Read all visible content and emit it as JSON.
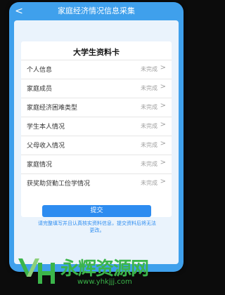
{
  "header": {
    "title": "家庭经济情况信息采集"
  },
  "card": {
    "title": "大学生资料卡",
    "rows": [
      {
        "label": "个人信息",
        "status": "未完成"
      },
      {
        "label": "家庭成员",
        "status": "未完成"
      },
      {
        "label": "家庭经济困难类型",
        "status": "未完成"
      },
      {
        "label": "学生本人情况",
        "status": "未完成"
      },
      {
        "label": "父母收入情况",
        "status": "未完成"
      },
      {
        "label": "家庭情况",
        "status": "未完成"
      },
      {
        "label": "获奖助贷勤工俭学情况",
        "status": "未完成"
      }
    ]
  },
  "footer": {
    "submit_label": "提交",
    "notice": "请完整填写并且认真核实资料信息，提交资料后将无法更改。"
  },
  "watermark": {
    "brand": "永辉资源网",
    "url": "www.yhkjjj.com"
  },
  "colors": {
    "accent": "#2d8cf0",
    "screen_bg": "#eaf3fc",
    "phone": "#3fa0ec"
  }
}
